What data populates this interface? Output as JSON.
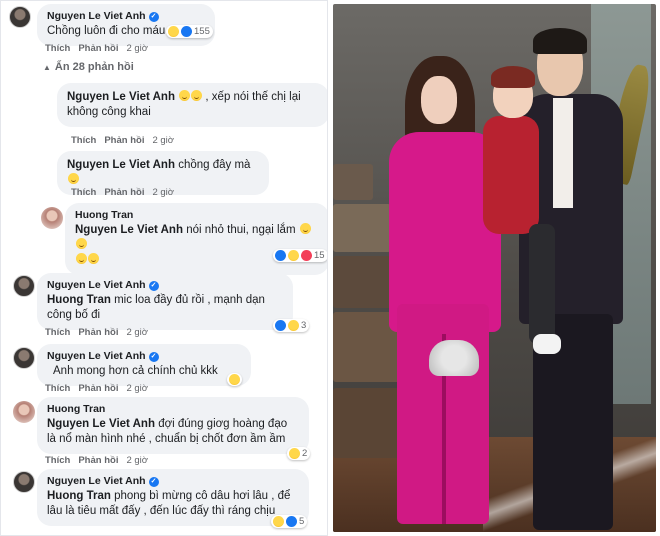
{
  "colors": {
    "bubble_bg": "#f0f2f5",
    "verified": "#1877f2",
    "meta_text": "#65676b",
    "suit_pink": "#d6198a"
  },
  "top_comment": {
    "author": "Nguyen Le Viet Anh",
    "text": "Chồng luôn đi cho máu",
    "reaction_count": "155",
    "actions": {
      "like": "Thích",
      "reply": "Phản hồi",
      "time": "2 giờ"
    }
  },
  "hidden_replies": "Ẩn 28 phản hồi",
  "replies": [
    {
      "author": "Nguyen Le Viet Anh",
      "text": ", xếp nói thế chị lại không công khai",
      "actions": {
        "like": "Thích",
        "reply": "Phản hồi",
        "time": "2 giờ"
      }
    },
    {
      "author": "Nguyen Le Viet Anh",
      "text": "chồng đây mà",
      "actions": {
        "like": "Thích",
        "reply": "Phản hồi",
        "time": "2 giờ"
      }
    },
    {
      "author": "Huong Tran",
      "mention": "Nguyen Le Viet Anh",
      "text": "nói nhỏ thui, ngại lắm",
      "reaction_count": "15"
    },
    {
      "author": "Nguyen Le Viet Anh",
      "mention": "Huong Tran",
      "text": "mic loa đầy đủ rồi , mạnh dạn công bố đi",
      "reaction_count": "3",
      "actions": {
        "like": "Thích",
        "reply": "Phản hồi",
        "time": "2 giờ"
      }
    },
    {
      "author": "Nguyen Le Viet Anh",
      "text": "Anh mong hơn cả chính chủ kkk",
      "actions": {
        "like": "Thích",
        "reply": "Phản hồi",
        "time": "2 giờ"
      }
    },
    {
      "author": "Huong Tran",
      "mention": "Nguyen Le Viet Anh",
      "text": "đợi đúng giơg hoàng đạo là nổ màn hình nhé , chuẩn bị chốt đơn ầm ầm",
      "reaction_count": "2",
      "actions": {
        "like": "Thích",
        "reply": "Phản hồi",
        "time": "2 giờ"
      }
    },
    {
      "author": "Nguyen Le Viet Anh",
      "mention": "Huong Tran",
      "text": "phong bì mừng cô dâu hơi lâu , để lâu là tiêu mất đấy , đến lúc đấy thì ráng chịu",
      "reaction_count": "5"
    }
  ]
}
